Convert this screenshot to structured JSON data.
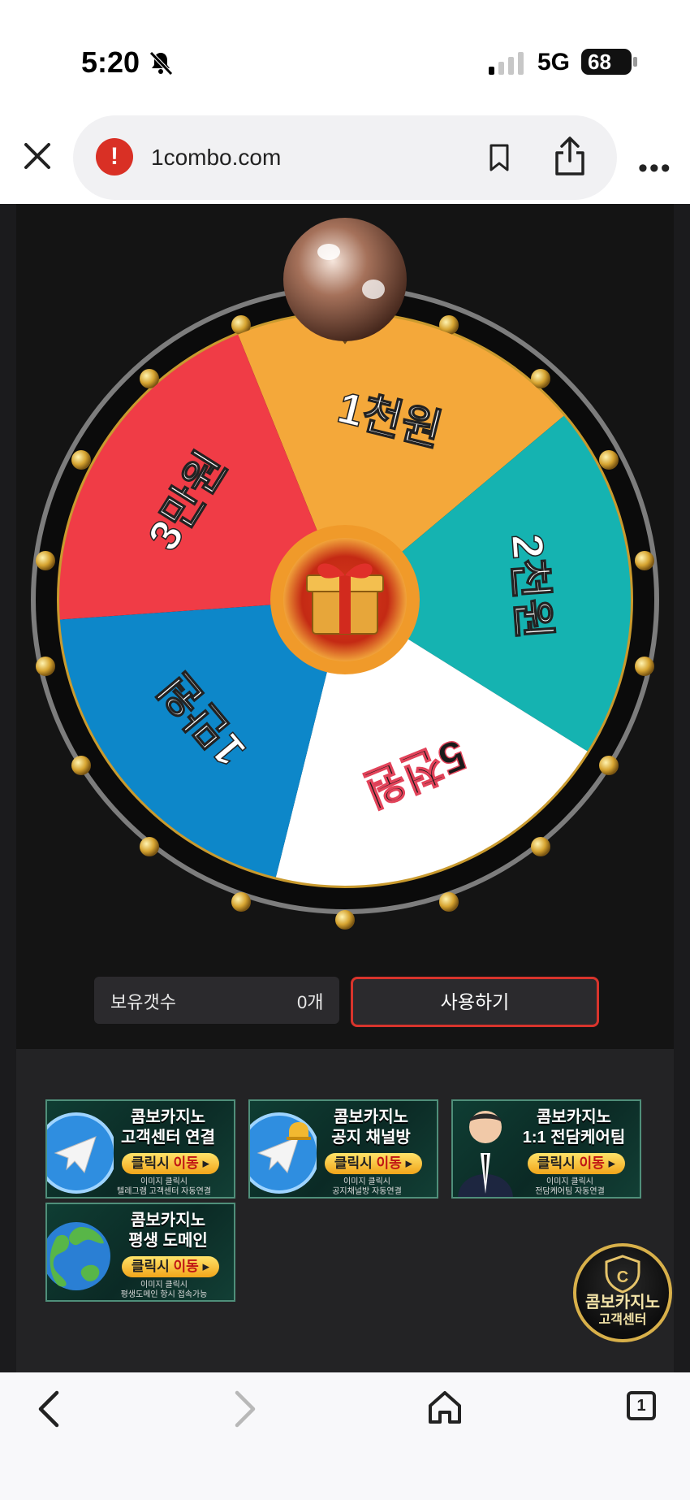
{
  "status_bar": {
    "time": "5:20",
    "network": "5G",
    "battery": "68"
  },
  "browser": {
    "url": "1combo.com",
    "icons": [
      "close-icon",
      "warning-icon",
      "bookmark-icon",
      "share-icon",
      "more-icon"
    ]
  },
  "wheel": {
    "segments": [
      {
        "label": "1천원",
        "color": "#f4a83a"
      },
      {
        "label": "2천원",
        "color": "#15b3b1"
      },
      {
        "label": "5천원",
        "color": "#ffffff"
      },
      {
        "label": "1만원",
        "color": "#0d87c9"
      },
      {
        "label": "3만원",
        "color": "#f03c46"
      }
    ],
    "center_icon": "gift-icon"
  },
  "controls": {
    "holdings_label": "보유갯수",
    "holdings_value": "0개",
    "use_button": "사용하기"
  },
  "banners": [
    {
      "line1": "콤보카지노",
      "line2": "고객센터 연결",
      "button_a": "클릭시 ",
      "button_b": "이동",
      "sub1": "이미지 클릭시",
      "sub2": "텔레그램 고객센터 자동연결",
      "icon": "telegram-icon"
    },
    {
      "line1": "콤보카지노",
      "line2": "공지 채널방",
      "button_a": "클릭시 ",
      "button_b": "이동",
      "sub1": "이미지 클릭시",
      "sub2": "공지채널방 자동연결",
      "icon": "telegram-bell-icon"
    },
    {
      "line1": "콤보카지노",
      "line2": "1:1 전담케어팀",
      "button_a": "클릭시 ",
      "button_b": "이동",
      "sub1": "이미지 클릭시",
      "sub2": "전담케어팀 자동연결",
      "icon": "agent-avatar-icon"
    },
    {
      "line1": "콤보카지노",
      "line2": "평생 도메인",
      "button_a": "클릭시 ",
      "button_b": "이동",
      "sub1": "이미지 클릭시",
      "sub2": "평생도메인 항시 접속가능",
      "icon": "globe-icon"
    }
  ],
  "support_badge": {
    "line1": "콤보카지노",
    "line2": "고객센터"
  },
  "bottom_nav": {
    "tab_count": "1",
    "icons": [
      "back-icon",
      "forward-icon",
      "home-icon",
      "tabs-icon"
    ]
  }
}
